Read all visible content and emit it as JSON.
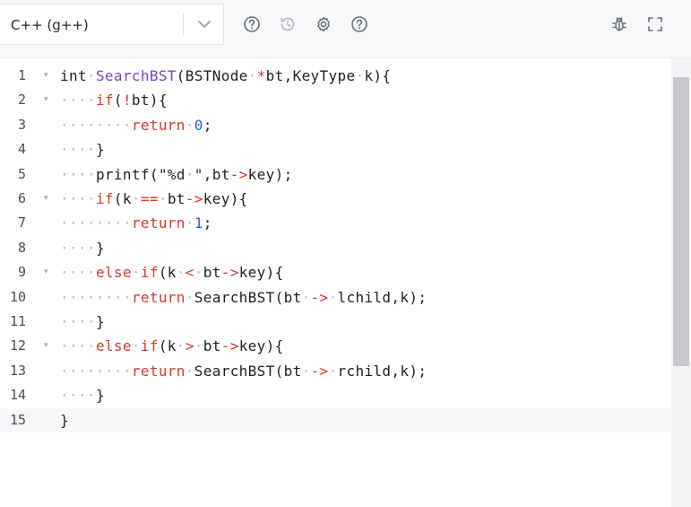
{
  "toolbar": {
    "language": "C++ (g++)",
    "icons": [
      "chevron-down-icon",
      "help-icon",
      "history-icon",
      "settings-icon",
      "help-icon",
      "debug-icon",
      "fullscreen-icon"
    ]
  },
  "editor": {
    "line_numbers": [
      "1",
      "2",
      "3",
      "4",
      "5",
      "6",
      "7",
      "8",
      "9",
      "10",
      "11",
      "12",
      "13",
      "14",
      "15"
    ],
    "fold_markers": [
      "▾",
      "▾",
      "",
      "",
      "",
      "▾",
      "",
      "",
      "▾",
      "",
      "",
      "▾",
      "",
      "",
      ""
    ],
    "lines": [
      [
        [
          "int",
          "plain"
        ],
        [
          "·",
          "ws"
        ],
        [
          "SearchBST",
          "fn"
        ],
        [
          "(BSTNode",
          "plain"
        ],
        [
          "·",
          "ws"
        ],
        [
          "*",
          "op"
        ],
        [
          "bt,KeyType",
          "plain"
        ],
        [
          "·",
          "ws"
        ],
        [
          "k){",
          "plain"
        ]
      ],
      [
        [
          "····",
          "ws"
        ],
        [
          "if",
          "kw"
        ],
        [
          "(",
          "plain"
        ],
        [
          "!",
          "op"
        ],
        [
          "bt){",
          "plain"
        ]
      ],
      [
        [
          "········",
          "ws"
        ],
        [
          "return",
          "kw"
        ],
        [
          "·",
          "ws"
        ],
        [
          "0",
          "num"
        ],
        [
          ";",
          "plain"
        ]
      ],
      [
        [
          "····",
          "ws"
        ],
        [
          "}",
          "plain"
        ]
      ],
      [
        [
          "····",
          "ws"
        ],
        [
          "printf(\"%d",
          "plain"
        ],
        [
          "·",
          "ws"
        ],
        [
          "\",bt",
          "plain"
        ],
        [
          "->",
          "op"
        ],
        [
          "key);",
          "plain"
        ]
      ],
      [
        [
          "····",
          "ws"
        ],
        [
          "if",
          "kw"
        ],
        [
          "(k",
          "plain"
        ],
        [
          "·",
          "ws"
        ],
        [
          "==",
          "op"
        ],
        [
          "·",
          "ws"
        ],
        [
          "bt",
          "plain"
        ],
        [
          "->",
          "op"
        ],
        [
          "key){",
          "plain"
        ]
      ],
      [
        [
          "········",
          "ws"
        ],
        [
          "return",
          "kw"
        ],
        [
          "·",
          "ws"
        ],
        [
          "1",
          "num"
        ],
        [
          ";",
          "plain"
        ]
      ],
      [
        [
          "····",
          "ws"
        ],
        [
          "}",
          "plain"
        ]
      ],
      [
        [
          "····",
          "ws"
        ],
        [
          "else",
          "kw"
        ],
        [
          "·",
          "ws"
        ],
        [
          "if",
          "kw"
        ],
        [
          "(k",
          "plain"
        ],
        [
          "·",
          "ws"
        ],
        [
          "<",
          "op"
        ],
        [
          "·",
          "ws"
        ],
        [
          "bt",
          "plain"
        ],
        [
          "->",
          "op"
        ],
        [
          "key){",
          "plain"
        ]
      ],
      [
        [
          "········",
          "ws"
        ],
        [
          "return",
          "kw"
        ],
        [
          "·",
          "ws"
        ],
        [
          "SearchBST(bt",
          "plain"
        ],
        [
          "·",
          "ws"
        ],
        [
          "->",
          "op"
        ],
        [
          "·",
          "ws"
        ],
        [
          "lchild,k);",
          "plain"
        ]
      ],
      [
        [
          "····",
          "ws"
        ],
        [
          "}",
          "plain"
        ]
      ],
      [
        [
          "····",
          "ws"
        ],
        [
          "else",
          "kw"
        ],
        [
          "·",
          "ws"
        ],
        [
          "if",
          "kw"
        ],
        [
          "(k",
          "plain"
        ],
        [
          "·",
          "ws"
        ],
        [
          ">",
          "op"
        ],
        [
          "·",
          "ws"
        ],
        [
          "bt",
          "plain"
        ],
        [
          "->",
          "op"
        ],
        [
          "key){",
          "plain"
        ]
      ],
      [
        [
          "········",
          "ws"
        ],
        [
          "return",
          "kw"
        ],
        [
          "·",
          "ws"
        ],
        [
          "SearchBST(bt",
          "plain"
        ],
        [
          "·",
          "ws"
        ],
        [
          "->",
          "op"
        ],
        [
          "·",
          "ws"
        ],
        [
          "rchild,k);",
          "plain"
        ]
      ],
      [
        [
          "····",
          "ws"
        ],
        [
          "}",
          "plain"
        ]
      ],
      [
        [
          "}",
          "plain"
        ]
      ]
    ],
    "active_line": 15
  }
}
